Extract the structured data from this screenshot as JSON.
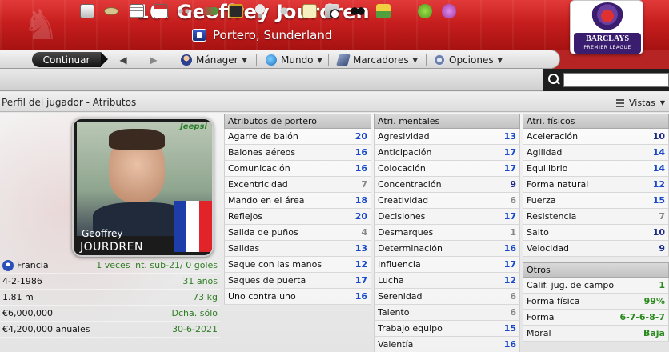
{
  "header": {
    "title": "16. Geoffrey Jourdren",
    "subtitle": "Portero, Sunderland"
  },
  "league_logo": {
    "brand": "BARCLAYS",
    "sub": "PREMIER LEAGUE"
  },
  "toolbar": {
    "continue_label": "Continuar",
    "menus": [
      {
        "label": "Mánager",
        "icon": "manager-icon"
      },
      {
        "label": "Mundo",
        "icon": "globe-icon"
      },
      {
        "label": "Marcadores",
        "icon": "bookmarks-icon"
      },
      {
        "label": "Opciones",
        "icon": "options-icon"
      }
    ]
  },
  "iconbar": {
    "icons": [
      "home-icon",
      "inbox-icon",
      "news-icon",
      "calendar-icon",
      "squad-icon",
      "transfers-icon",
      "tactics-icon",
      "trophy-icon",
      "staff-icon",
      "clipboard-icon",
      "training-icon",
      "scouting-icon",
      "finances-icon",
      "help-icon",
      "question-icon"
    ]
  },
  "search": {
    "placeholder": ""
  },
  "page": {
    "breadcrumb": "Perfil del jugador - Atributos",
    "views_label": "Vistas"
  },
  "card": {
    "first_name": "Geoffrey",
    "last_name": "JOURDREN",
    "club_logo_text": "Jeepsi",
    "flag_colors": [
      "#1d3ea8",
      "#ffffff",
      "#e0242a"
    ]
  },
  "bio": [
    {
      "label": "Francia",
      "value": "1 veces int. sub-21/ 0 goles",
      "icon": "nation-icon"
    },
    {
      "label": "4-2-1986",
      "value": "31 años"
    },
    {
      "label": "1.81 m",
      "value": "73 kg"
    },
    {
      "label": "€6,000,000",
      "value": "Dcha. sólo"
    },
    {
      "label": "€4,200,000 anuales",
      "value": "30-6-2021"
    }
  ],
  "panels": {
    "goalkeeper": {
      "title": "Atributos de portero",
      "rows": [
        {
          "name": "Agarre de balón",
          "value": "20"
        },
        {
          "name": "Balones aéreos",
          "value": "16"
        },
        {
          "name": "Comunicación",
          "value": "16"
        },
        {
          "name": "Excentricidad",
          "value": "7"
        },
        {
          "name": "Mando en el área",
          "value": "18"
        },
        {
          "name": "Reflejos",
          "value": "20"
        },
        {
          "name": "Salida de puños",
          "value": "4"
        },
        {
          "name": "Salidas",
          "value": "13"
        },
        {
          "name": "Saque con las manos",
          "value": "12"
        },
        {
          "name": "Saques de puerta",
          "value": "17"
        },
        {
          "name": "Uno contra uno",
          "value": "16"
        }
      ]
    },
    "mental": {
      "title": "Atri. mentales",
      "rows": [
        {
          "name": "Agresividad",
          "value": "13"
        },
        {
          "name": "Anticipación",
          "value": "17"
        },
        {
          "name": "Colocación",
          "value": "17"
        },
        {
          "name": "Concentración",
          "value": "9"
        },
        {
          "name": "Creatividad",
          "value": "6"
        },
        {
          "name": "Decisiones",
          "value": "17"
        },
        {
          "name": "Desmarques",
          "value": "1"
        },
        {
          "name": "Determinación",
          "value": "16"
        },
        {
          "name": "Influencia",
          "value": "17"
        },
        {
          "name": "Lucha",
          "value": "12"
        },
        {
          "name": "Serenidad",
          "value": "6"
        },
        {
          "name": "Talento",
          "value": "6"
        },
        {
          "name": "Trabajo equipo",
          "value": "15"
        },
        {
          "name": "Valentía",
          "value": "16"
        }
      ]
    },
    "physical": {
      "title": "Atri. físicos",
      "rows": [
        {
          "name": "Aceleración",
          "value": "10"
        },
        {
          "name": "Agilidad",
          "value": "14"
        },
        {
          "name": "Equilibrio",
          "value": "14"
        },
        {
          "name": "Forma natural",
          "value": "12"
        },
        {
          "name": "Fuerza",
          "value": "15"
        },
        {
          "name": "Resistencia",
          "value": "7"
        },
        {
          "name": "Salto",
          "value": "10"
        },
        {
          "name": "Velocidad",
          "value": "9"
        }
      ]
    },
    "others": {
      "title": "Otros",
      "rows": [
        {
          "name": "Calif. jug. de campo",
          "value": "1"
        },
        {
          "name": "Forma física",
          "value": "99%"
        },
        {
          "name": "Forma",
          "value": "6-7-6-8-7"
        },
        {
          "name": "Moral",
          "value": "Baja"
        }
      ]
    }
  }
}
